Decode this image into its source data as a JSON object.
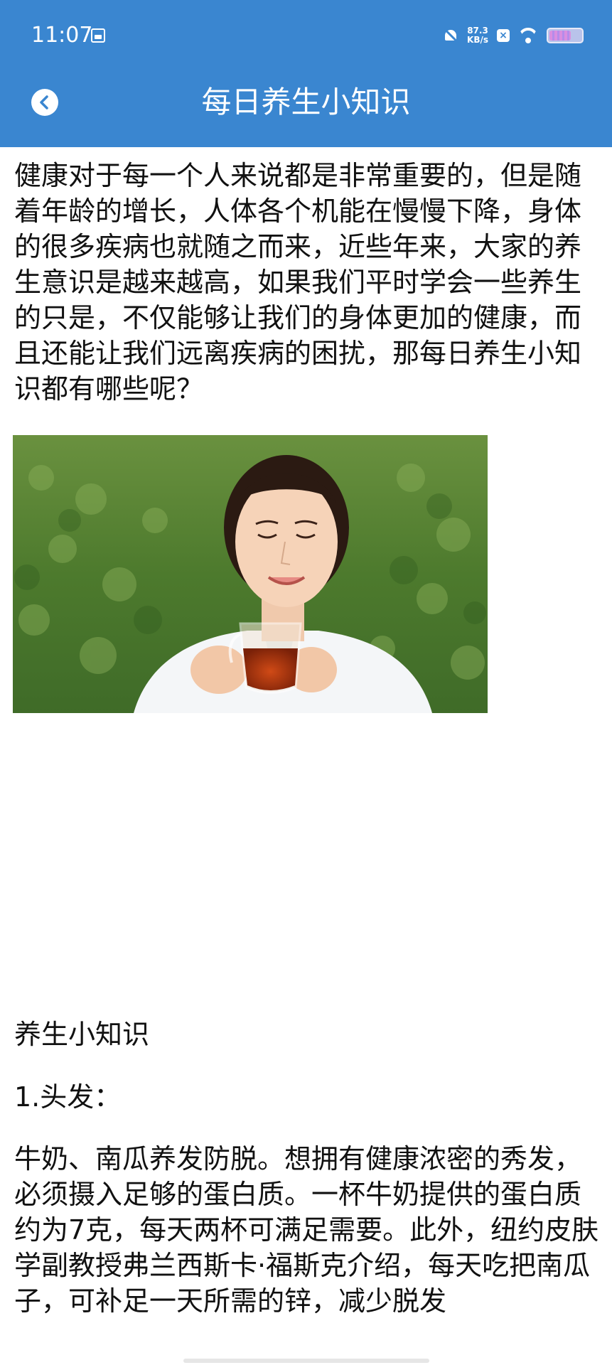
{
  "status_bar": {
    "time": "11:07",
    "net_speed_value": "87.3",
    "net_speed_unit": "KB/s"
  },
  "header": {
    "title": "每日养生小知识"
  },
  "article": {
    "intro": "健康对于每一个人来说都是非常重要的，但是随着年龄的增长，人体各个机能在慢慢下降，身体的很多疾病也就随之而来，近些年来，大家的养生意识是越来越高，如果我们平时学会一些养生的只是，不仅能够让我们的身体更加的健康，而且还能让我们远离疾病的困扰，那每日养生小知识都有哪些呢？",
    "section_title": "养生小知识",
    "item1_title": "1.头发：",
    "item1_text": "牛奶、南瓜养发防脱。想拥有健康浓密的秀发，必须摄入足够的蛋白质。一杯牛奶提供的蛋白质约为7克，每天两杯可满足需要。此外，纽约皮肤学副教授弗兰西斯卡·福斯克介绍，每天吃把南瓜子，可补足一天所需的锌，减少脱发"
  }
}
